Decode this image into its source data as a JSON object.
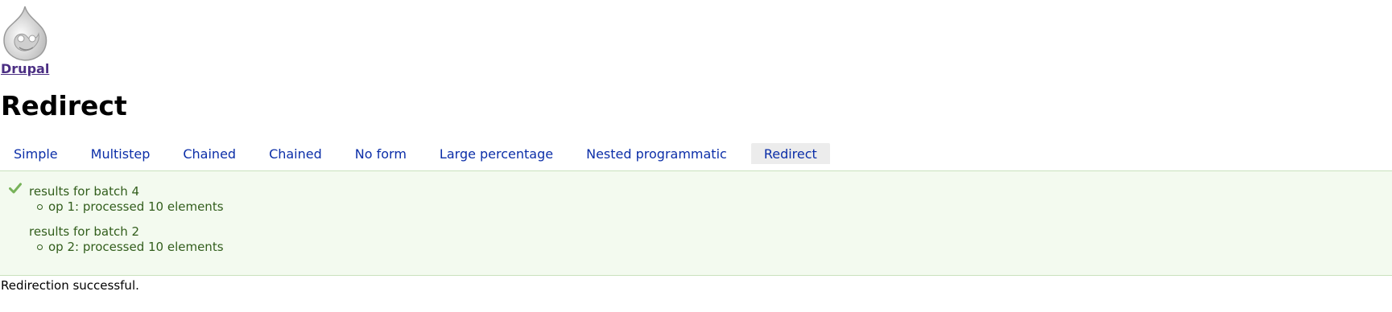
{
  "site": {
    "name": "Drupal",
    "logo_icon": "drupal-drop-logo-icon"
  },
  "page": {
    "title": "Redirect"
  },
  "tabs": [
    {
      "label": "Simple",
      "active": false
    },
    {
      "label": "Multistep",
      "active": false
    },
    {
      "label": "Chained",
      "active": false
    },
    {
      "label": "Chained",
      "active": false
    },
    {
      "label": "No form",
      "active": false
    },
    {
      "label": "Large percentage",
      "active": false
    },
    {
      "label": "Nested programmatic",
      "active": false
    },
    {
      "label": "Redirect",
      "active": true
    }
  ],
  "messages": {
    "status_icon": "check-icon",
    "colors": {
      "background": "#f3faef",
      "text": "#325e1c",
      "check": "#77b259"
    },
    "batches": [
      {
        "title": "results for batch 4",
        "items": [
          "op 1: processed 10 elements"
        ]
      },
      {
        "title": "results for batch 2",
        "items": [
          "op 2: processed 10 elements"
        ]
      }
    ]
  },
  "content": {
    "text": "Redirection successful."
  }
}
